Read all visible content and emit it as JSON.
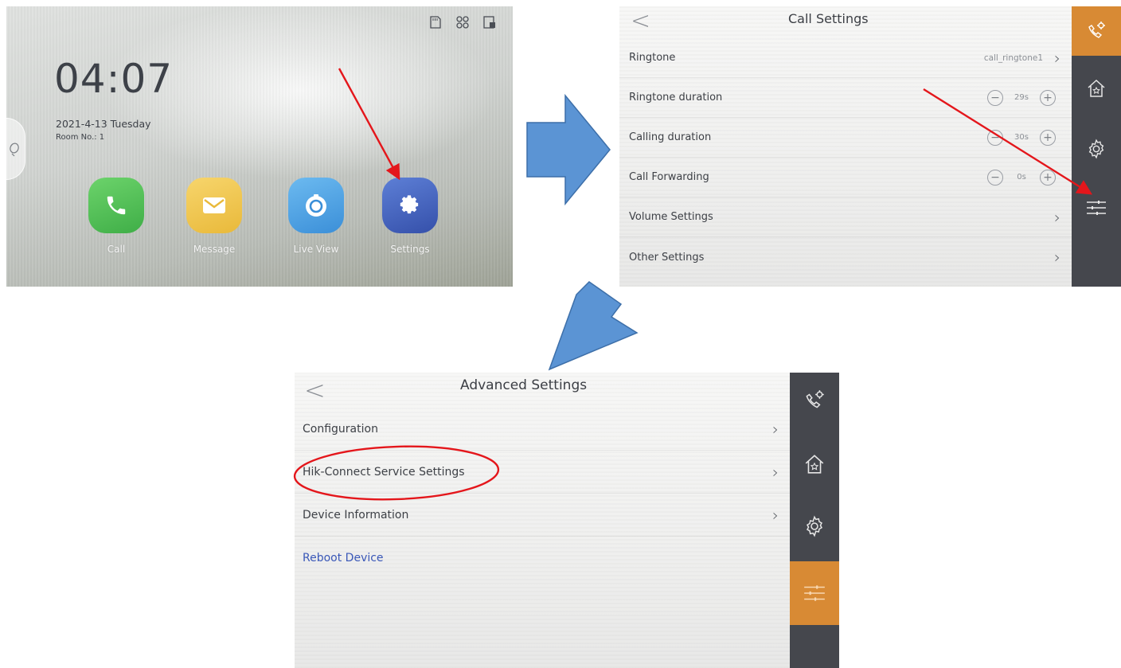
{
  "home": {
    "time": "04:07",
    "date": "2021-4-13  Tuesday",
    "room": "Room No.: 1",
    "apps": [
      {
        "label": "Call",
        "icon": "phone-icon",
        "color": "#4fbe53"
      },
      {
        "label": "Message",
        "icon": "envelope-icon",
        "color": "#f0c64d"
      },
      {
        "label": "Live View",
        "icon": "camera-icon",
        "color": "#4aa3e4"
      },
      {
        "label": "Settings",
        "icon": "gear-icon",
        "color": "#4463bf"
      }
    ],
    "status_icons": [
      "sd-card-icon",
      "network-icon",
      "lock-icon"
    ]
  },
  "call_settings": {
    "back": "<",
    "title": "Call Settings",
    "rows": [
      {
        "label": "Ringtone",
        "value": "call_ringtone1"
      },
      {
        "label": "Ringtone duration",
        "value": "29s"
      },
      {
        "label": "Calling duration",
        "value": "30s"
      },
      {
        "label": "Call Forwarding",
        "value": "0s"
      },
      {
        "label": "Volume Settings"
      },
      {
        "label": "Other Settings"
      }
    ],
    "rail_icons": [
      "phone-gear-icon",
      "home-icon",
      "gear-icon",
      "sliders-icon"
    ],
    "rail_active": "phone-gear-icon"
  },
  "advanced_settings": {
    "back": "<",
    "title": "Advanced Settings",
    "rows": [
      {
        "label": "Configuration"
      },
      {
        "label": "Hik-Connect Service Settings"
      },
      {
        "label": "Device Information"
      },
      {
        "label": "Reboot Device"
      }
    ],
    "rail_icons": [
      "phone-gear-icon",
      "home-icon",
      "gear-icon",
      "sliders-icon"
    ],
    "rail_active": "sliders-icon"
  },
  "colors": {
    "rail": "#45474d",
    "rail_active": "#d88a34",
    "annotation": "#e4161b",
    "flow_arrow": "#5b94d4",
    "link": "#3a58b8"
  }
}
